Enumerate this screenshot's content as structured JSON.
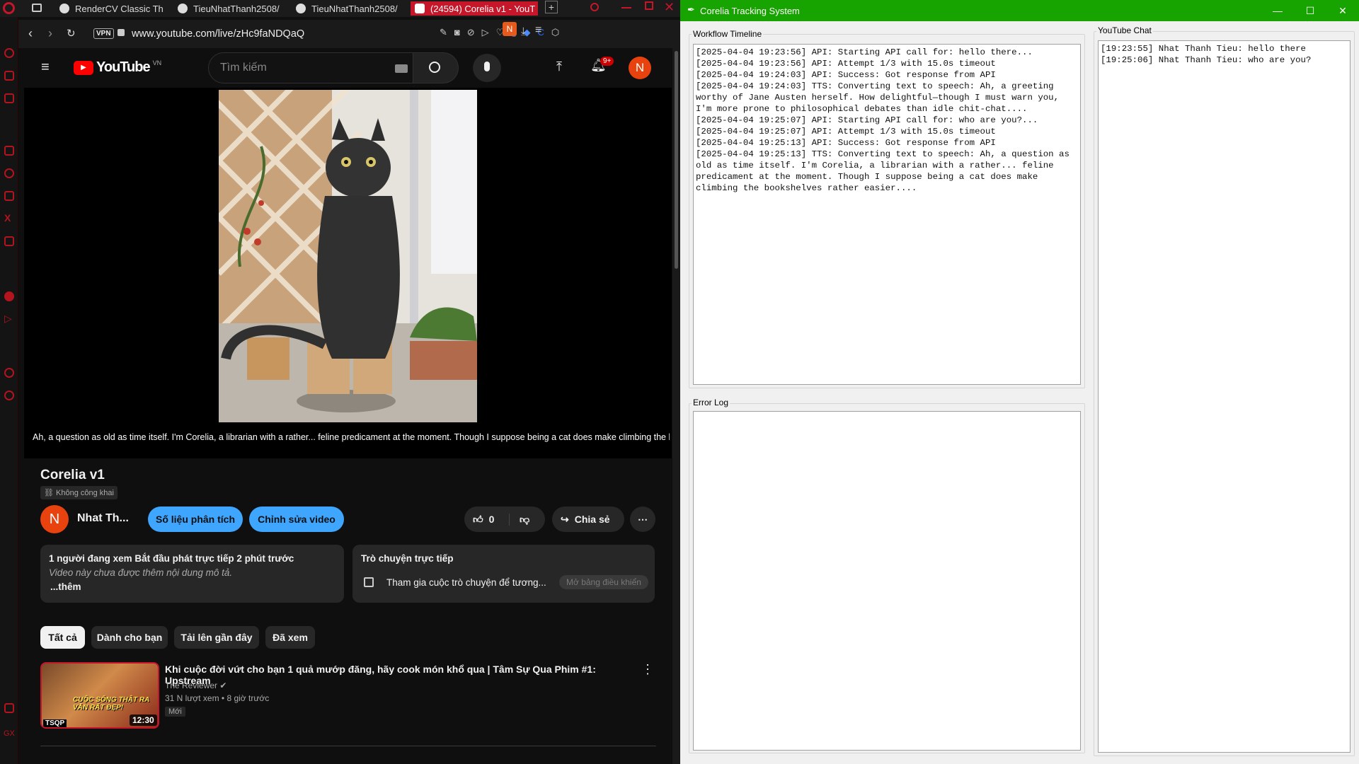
{
  "browser": {
    "tabs": [
      {
        "label": "RenderCV Classic Th"
      },
      {
        "label": "TieuNhatThanh2508/"
      },
      {
        "label": "TieuNhatThanh2508/"
      },
      {
        "label": "(24594) Corelia v1 - YouT"
      }
    ],
    "url": "www.youtube.com/live/zHc9faNDQaQ",
    "vpn_label": "VPN",
    "profile_initial": "N"
  },
  "youtube": {
    "logo": "YouTube",
    "logo_region": "VN",
    "search_placeholder": "Tìm kiếm",
    "notif_badge": "9+",
    "avatar_initial": "N",
    "caption": "Ah, a question as old as time itself. I'm Corelia, a librarian with a rather... feline predicament at the moment. Though I suppose being a cat does make climbing the bookshelves rather easier....",
    "video_title": "Corelia v1",
    "privacy": "Không công khai",
    "channel_initial": "N",
    "channel_name": "Nhat Th...",
    "analytics_btn": "Số liệu phân tích",
    "edit_btn": "Chỉnh sửa video",
    "like_count": "0",
    "share_btn": "Chia sẻ",
    "desc_stats": "1 người đang xem  Bắt đầu phát trực tiếp 2 phút trước",
    "desc_text": "Video này chưa được thêm nội dung mô tả.",
    "desc_more": "...thêm",
    "live_chat_title": "Trò chuyện trực tiếp",
    "live_chat_text": "Tham gia cuộc trò chuyện để tương...",
    "live_chat_btn": "Mở bảng điều khiển",
    "chips": [
      "Tất cả",
      "Dành cho bạn",
      "Tải lên gần đây",
      "Đã xem"
    ],
    "rec": {
      "title": "Khi cuộc đời vứt cho bạn 1 quả mướp đăng, hãy cook món khổ qua | Tâm Sự Qua Phim #1: Upstream",
      "channel": "The Reviewer",
      "meta": "31 N lượt xem  • 8 giờ trước",
      "badge": "Mới",
      "duration": "12:30",
      "thumb_text": "CUỘC SỐNG THẬT RA VẪN RẤT ĐẸP!",
      "thumb_tag": "TSQP"
    }
  },
  "app": {
    "title": "Corelia Tracking System",
    "workflow_label": "Workflow Timeline",
    "workflow_text": "[2025-04-04 19:23:56] API: Starting API call for: hello there...\n[2025-04-04 19:23:56] API: Attempt 1/3 with 15.0s timeout\n[2025-04-04 19:24:03] API: Success: Got response from API\n[2025-04-04 19:24:03] TTS: Converting text to speech: Ah, a greeting worthy of Jane Austen herself. How delightful—though I must warn you, I'm more prone to philosophical debates than idle chit-chat....\n[2025-04-04 19:25:07] API: Starting API call for: who are you?...\n[2025-04-04 19:25:07] API: Attempt 1/3 with 15.0s timeout\n[2025-04-04 19:25:13] API: Success: Got response from API\n[2025-04-04 19:25:13] TTS: Converting text to speech: Ah, a question as old as time itself. I'm Corelia, a librarian with a rather... feline predicament at the moment. Though I suppose being a cat does make climbing the bookshelves rather easier....",
    "error_label": "Error Log",
    "error_text": "",
    "chat_label": "YouTube Chat",
    "chat_text": "[19:23:55] Nhat Thanh Tieu: hello there\n[19:25:06] Nhat Thanh Tieu: who are you?"
  }
}
